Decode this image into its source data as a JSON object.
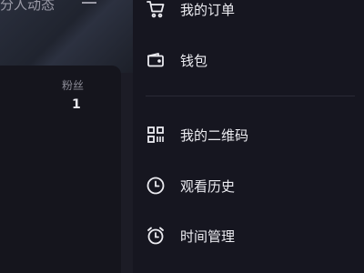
{
  "background": {
    "top_left_text": "分人动态",
    "fans_label": "粉丝",
    "fans_count": "1"
  },
  "drawer": {
    "items": [
      {
        "label": "我的订单",
        "icon": "cart-icon"
      },
      {
        "label": "钱包",
        "icon": "wallet-icon"
      },
      {
        "label": "我的二维码",
        "icon": "qrcode-icon"
      },
      {
        "label": "观看历史",
        "icon": "clock-icon"
      },
      {
        "label": "时间管理",
        "icon": "alarm-clock-icon"
      }
    ]
  },
  "colors": {
    "drawer_bg": "#161620",
    "text": "#ececf1",
    "muted": "#8a8a95"
  }
}
